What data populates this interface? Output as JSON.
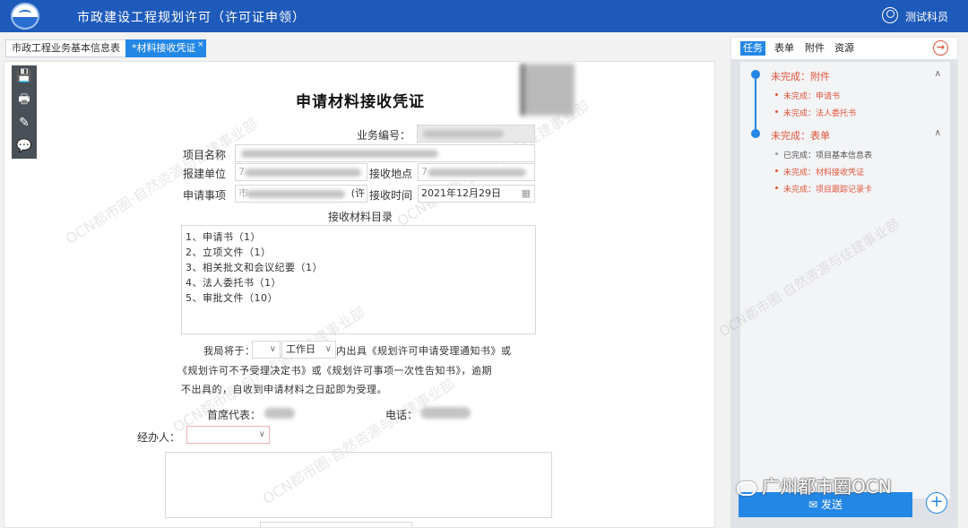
{
  "header": {
    "title": "市政建设工程规划许可（许可证申领）",
    "user": "测试科员"
  },
  "tabs": [
    {
      "label": "市政工程业务基本信息表"
    },
    {
      "label": "*材料接收凭证",
      "close": "×"
    }
  ],
  "toolbar": {
    "save": "💾",
    "print": "🖶",
    "edit": "✎",
    "comment": "💬"
  },
  "form": {
    "title": "申请材料接收凭证",
    "business_no_label": "业务编号：",
    "project_name_label": "项目名称",
    "unit_label": "报建单位",
    "receive_place_label": "接收地点",
    "apply_item_label": "申请事项",
    "apply_item_prefix": "市",
    "apply_item_suffix": "(许",
    "receive_time_label": "接收时间",
    "receive_time_value": "2021年12月29日",
    "unit_prefix": "7",
    "place_prefix": "7",
    "catalog_title": "接收材料目录",
    "catalog_items": [
      "1、申请书（1）",
      "2、立项文件（1）",
      "3、相关批文和会议纪要（1）",
      "4、法人委托书（1）",
      "5、审批文件（10）"
    ],
    "notice_prefix": "我局将于：",
    "workday_select": "工作日",
    "notice_line1_suffix": "内出具《规划许可申请受理通知书》或",
    "notice_line2": "《规划许可不予受理决定书》或《规划许可事项一次性告知书》，逾期",
    "notice_line3": "不出具的，自收到申请材料之日起即为受理。",
    "rep_label": "首席代表：",
    "phone_label": "电话：",
    "handler_label": "经办人："
  },
  "side": {
    "tabs": [
      "任务",
      "表单",
      "附件",
      "资源"
    ],
    "groups": [
      {
        "title": "未完成：附件",
        "items": [
          {
            "label": "未完成：申请书",
            "done": false
          },
          {
            "label": "未完成：法人委托书",
            "done": false
          }
        ]
      },
      {
        "title": "未完成：表单",
        "items": [
          {
            "label": "已完成：项目基本信息表",
            "done": true
          },
          {
            "label": "未完成：材料接收凭证",
            "done": false
          },
          {
            "label": "未完成：项目跟踪记录卡",
            "done": false
          }
        ]
      }
    ],
    "send_label": "发送",
    "send_icon": "✉"
  },
  "watermark": {
    "text1": "OCN都市圈·自然资源与住建事业部",
    "brand": "广州都市圈OCN"
  },
  "colors": {
    "header": "#1e5aba",
    "accent": "#2387e6",
    "pending": "#e0553a"
  }
}
